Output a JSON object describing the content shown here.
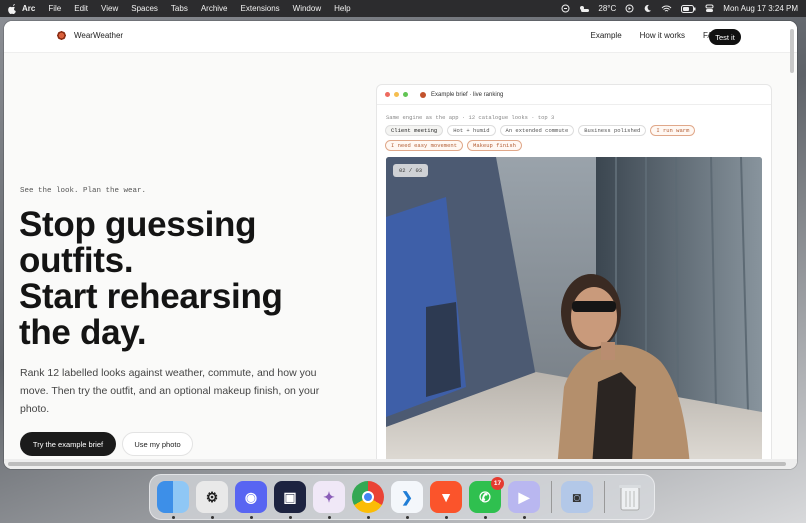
{
  "menubar": {
    "apple": "",
    "items": [
      "Arc",
      "File",
      "Edit",
      "View",
      "Spaces",
      "Tabs",
      "Archive",
      "Extensions",
      "Window",
      "Help"
    ],
    "weather": "28°C",
    "clock": "Mon Aug 17  3:24 PM"
  },
  "nav": {
    "brand": "WearWeather",
    "links": [
      "Example",
      "How it works",
      "FAQ"
    ],
    "cta": "Test it"
  },
  "hero": {
    "eyebrow": "See the look. Plan the wear.",
    "headline_line1": "Stop guessing",
    "headline_line2": "outfits.",
    "headline_line3": "Start rehearsing",
    "headline_line4": "the day.",
    "subtext": "Rank 12 labelled looks against weather, commute, and how you move. Then try the outfit, and an optional makeup finish, on your photo.",
    "primary_button": "Try the example brief",
    "secondary_button": "Use my photo"
  },
  "card": {
    "title": "Example brief · live ranking",
    "caption": "Same engine as the app · 12 catalogue looks · top 3",
    "tags": [
      {
        "label": "Client meeting",
        "style": "active"
      },
      {
        "label": "Hot + humid",
        "style": "plain"
      },
      {
        "label": "An extended commute",
        "style": "plain"
      },
      {
        "label": "Business polished",
        "style": "plain"
      },
      {
        "label": "I run warm",
        "style": "accent"
      },
      {
        "label": "I need easy movement",
        "style": "accent"
      },
      {
        "label": "Makeup finish",
        "style": "accent"
      }
    ],
    "counter": "02 / 03"
  },
  "dock": {
    "apps": [
      "finder-icon",
      "chatgpt-icon",
      "discord-icon",
      "terminal-icon",
      "affinity-icon",
      "chrome-icon",
      "vscode-icon",
      "brave-icon",
      "whatsapp-icon",
      "screen-recorder-icon",
      "utility-icon",
      "trash-icon"
    ],
    "whatsapp_badge": "17"
  },
  "colors": {
    "accent": "#c2522c",
    "dark": "#141414",
    "tag_accent": "#b25d34"
  }
}
